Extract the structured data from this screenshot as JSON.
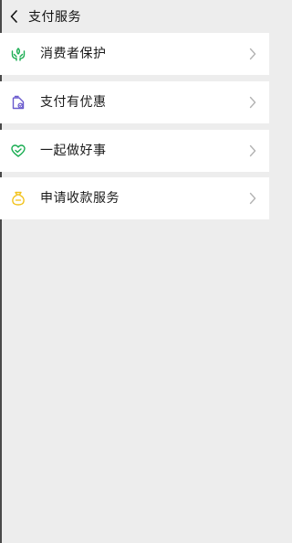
{
  "header": {
    "title": "支付服务",
    "back_icon": "chevron-left-icon"
  },
  "items": [
    {
      "label": "消费者保护",
      "icon": "protect-hands-icon",
      "icon_color": "#1aad52"
    },
    {
      "label": "支付有优惠",
      "icon": "discount-bag-icon",
      "icon_color": "#6a5acd"
    },
    {
      "label": "一起做好事",
      "icon": "charity-heart-icon",
      "icon_color": "#1aad52"
    },
    {
      "label": "申请收款服务",
      "icon": "money-bag-icon",
      "icon_color": "#f2c21a"
    }
  ],
  "colors": {
    "background": "#ededed",
    "card": "#ffffff",
    "chevron": "#b3b3b3"
  }
}
